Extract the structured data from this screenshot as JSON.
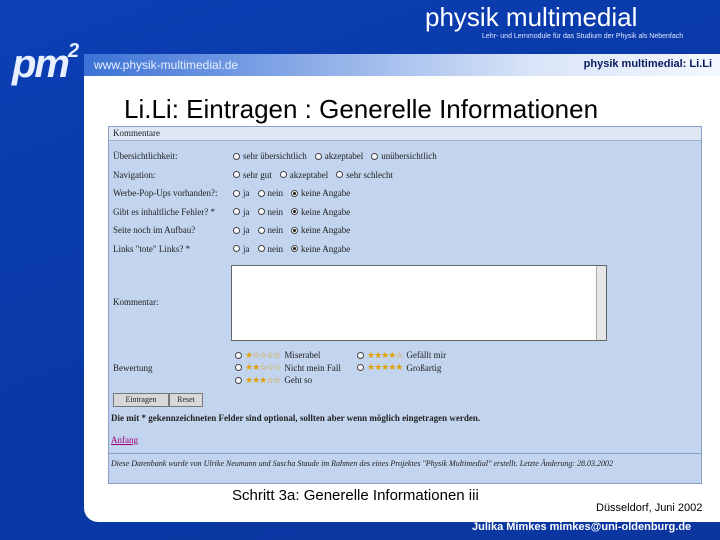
{
  "header": {
    "logo": "pm",
    "logo_sup": "2",
    "title": "physik multimedial",
    "subtitle": "Lehr- und Lernmodule für das Studium der Physik als Nebenfach",
    "url": "www.physik-multimedial.de",
    "section": "physik multimedial: Li.Li"
  },
  "slide": {
    "title": "Li.Li: Eintragen : Generelle Informationen",
    "caption": "Schritt 3a: Generelle Informationen iii",
    "place_date": "Düsseldorf, Juni 2002",
    "author": "Julika Mimkes mimkes@uni-oldenburg.de"
  },
  "form": {
    "header": "Kommentare",
    "rows": [
      {
        "label": "Übersichtlichkeit:",
        "options": [
          "sehr übersichtlich",
          "akzeptabel",
          "unübersichtlich"
        ],
        "selected": null
      },
      {
        "label": "Navigation:",
        "options": [
          "sehr gut",
          "akzeptabel",
          "sehr schlecht"
        ],
        "selected": null
      },
      {
        "label": "Werbe-Pop-Ups vorhanden?:",
        "options": [
          "ja",
          "nein",
          "keine Angabe"
        ],
        "selected": 2
      },
      {
        "label": "Gibt es inhaltliche Fehler? *",
        "options": [
          "ja",
          "nein",
          "keine Angabe"
        ],
        "selected": 2
      },
      {
        "label": "Seite noch im Aufbau?",
        "options": [
          "ja",
          "nein",
          "keine Angabe"
        ],
        "selected": 2
      },
      {
        "label": "Links \"tote\" Links? *",
        "options": [
          "ja",
          "nein",
          "keine Angabe"
        ],
        "selected": 2
      }
    ],
    "comment_label": "Kommentar:",
    "rating_label": "Bewertung",
    "ratings": [
      {
        "stars": "★☆☆☆☆",
        "label": "Miserabel"
      },
      {
        "stars": "★★★★☆",
        "label": "Gefällt mir"
      },
      {
        "stars": "★★☆☆☆",
        "label": "Nicht mein Fall"
      },
      {
        "stars": "★★★★★",
        "label": "Großartig"
      },
      {
        "stars": "★★★☆☆",
        "label": "Geht so"
      }
    ],
    "submit": "Eintragen",
    "reset": "Reset",
    "note": "Die mit * gekennzeichneten Felder sind optional, sollten aber wenn möglich eingetragen werden.",
    "link": "Anfang",
    "footer": "Diese Datenbank wurde von Ulrike Neumann und Sascha Staude im Rahmen des eines Projektes \"Physik Multimedial\" erstellt. Letzte Änderung: 28.03.2002"
  }
}
